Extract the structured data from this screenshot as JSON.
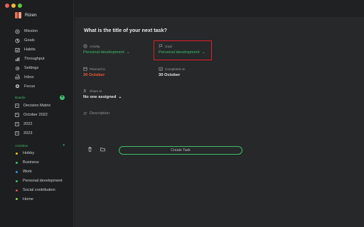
{
  "app": {
    "title": "Rizen"
  },
  "nav": [
    {
      "label": "Mission",
      "icon": "target-icon"
    },
    {
      "label": "Goals",
      "icon": "goals-icon"
    },
    {
      "label": "Habits",
      "icon": "habits-icon"
    },
    {
      "label": "Throughput",
      "icon": "chart-icon"
    },
    {
      "label": "Settings",
      "icon": "gear-icon"
    },
    {
      "label": "Inbox",
      "icon": "inbox-icon"
    },
    {
      "label": "Focus",
      "icon": "focus-icon"
    }
  ],
  "boards": {
    "title": "Boards",
    "items": [
      "Decision Matrix",
      "October 2022",
      "2022",
      "2023"
    ]
  },
  "activities": {
    "title": "Activities",
    "items": [
      {
        "label": "Hobby",
        "color": "#f0c419"
      },
      {
        "label": "Business",
        "color": "#3fbf6a"
      },
      {
        "label": "Work",
        "color": "#3a8fe0"
      },
      {
        "label": "Personal development",
        "color": "#3fbf6a"
      },
      {
        "label": "Social contribution",
        "color": "#e04a5a"
      },
      {
        "label": "Home",
        "color": "#8fcf5a"
      }
    ]
  },
  "task": {
    "title": "What is the title of your next task?",
    "activity_label": "Activity",
    "activity_value": "Personal development",
    "goal_label": "Goal",
    "goal_value": "Personal development",
    "planned_label": "Planned to",
    "planned_value": "30 October",
    "completed_label": "Completed on",
    "completed_value": "30 October",
    "share_label": "Share to",
    "share_value": "No one assigned",
    "description_placeholder": "Description",
    "create_button": "Create Task"
  },
  "colors": {
    "accent": "#3fbf6a",
    "warning": "#ee5a36",
    "highlight": "#e0202a"
  }
}
